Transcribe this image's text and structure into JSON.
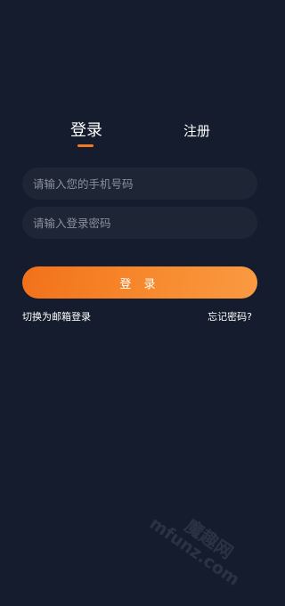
{
  "tabs": {
    "login": "登录",
    "register": "注册"
  },
  "phone": {
    "placeholder": "请输入您的手机号码"
  },
  "password": {
    "placeholder": "请输入登录密码"
  },
  "login_button": "登 录",
  "links": {
    "email_login": "切换为邮箱登录",
    "forgot_password": "忘记密码?"
  },
  "watermark": {
    "brand": "魔趣网",
    "domain": "mfunz.com"
  },
  "colors": {
    "background": "#141c2d",
    "accent": "#f07a22",
    "field": "#1e2535"
  }
}
